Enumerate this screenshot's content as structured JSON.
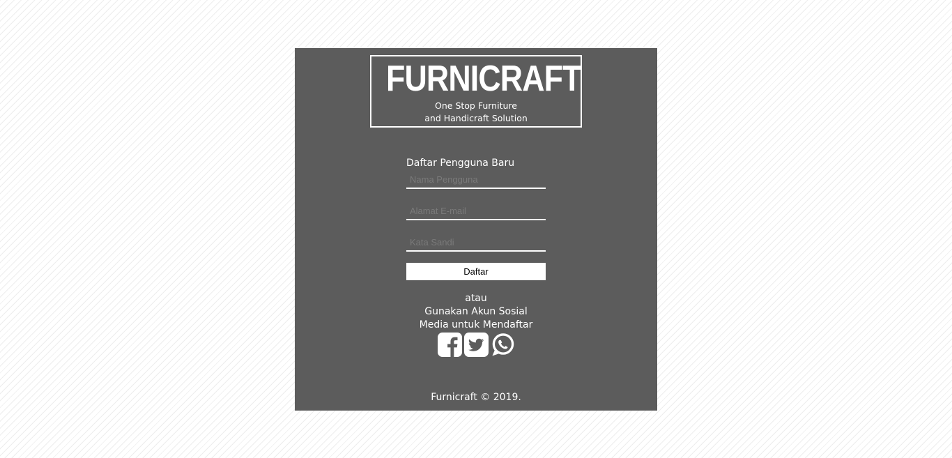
{
  "brand": {
    "name": "FURNICRAFT",
    "tagline_line1": "One Stop Furniture",
    "tagline_line2": "and Handicraft Solution"
  },
  "register_form": {
    "title": "Daftar Pengguna Baru",
    "username_placeholder": "Nama Pengguna",
    "email_placeholder": "Alamat E-mail",
    "password_placeholder": "Kata Sandi",
    "submit_label": "Daftar"
  },
  "social": {
    "or_text": "atau",
    "line1": "Gunakan Akun Sosial",
    "line2": "Media untuk Mendaftar",
    "icons": [
      "facebook-icon",
      "twitter-icon",
      "whatsapp-icon"
    ]
  },
  "footer": {
    "copyright": "Furnicraft © 2019."
  },
  "colors": {
    "card_background": "#5c5c5c",
    "text": "#ffffff"
  }
}
